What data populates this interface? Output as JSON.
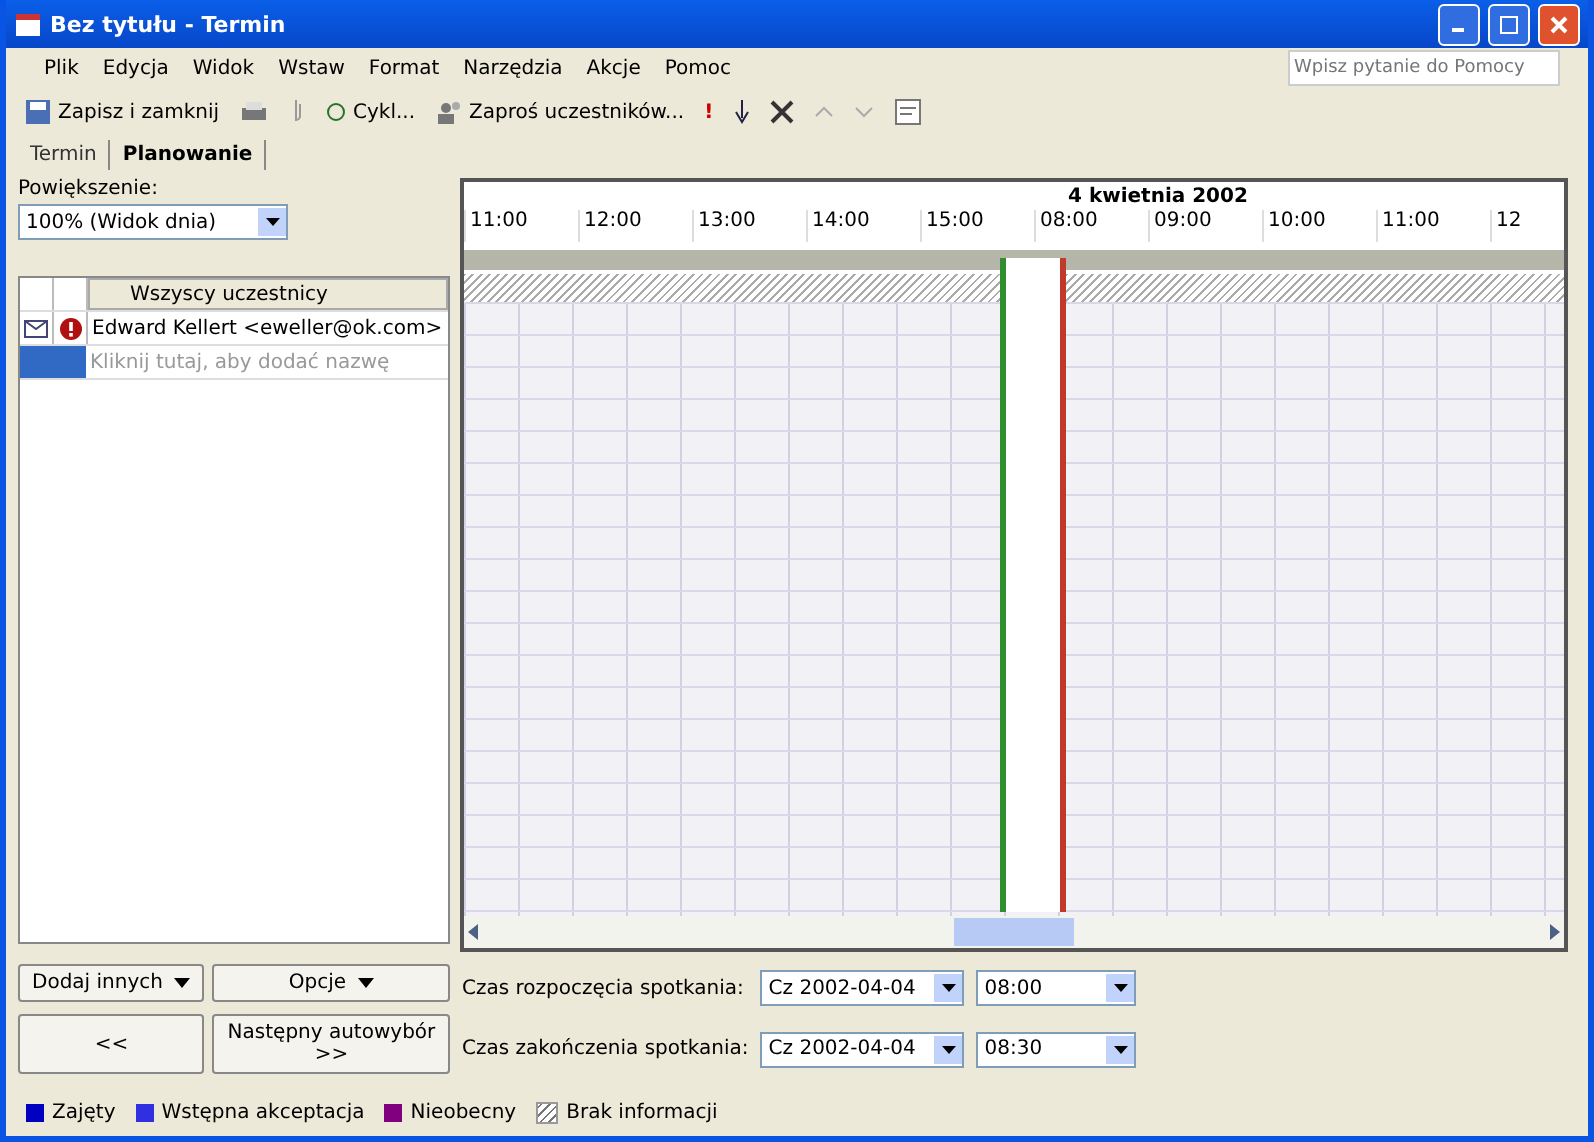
{
  "window": {
    "title": "Bez tytułu - Termin"
  },
  "menu": [
    "Plik",
    "Edycja",
    "Widok",
    "Wstaw",
    "Format",
    "Narzędzia",
    "Akcje",
    "Pomoc"
  ],
  "help_box": {
    "placeholder": "Wpisz pytanie do Pomocy"
  },
  "toolbar": [
    {
      "kind": "save",
      "label": "Zapisz i zamknij"
    },
    {
      "kind": "print"
    },
    {
      "kind": "attach"
    },
    {
      "kind": "recur",
      "label": "Cykl..."
    },
    {
      "kind": "invite",
      "label": "Zaproś uczestników..."
    },
    {
      "kind": "high",
      "label": "!"
    },
    {
      "kind": "low"
    },
    {
      "kind": "delete"
    },
    {
      "kind": "up"
    },
    {
      "kind": "down"
    },
    {
      "kind": "form"
    }
  ],
  "tabs": [
    {
      "label": "Termin",
      "selected": false
    },
    {
      "label": "Planowanie",
      "selected": true
    }
  ],
  "zoom": {
    "label": "Powiększenie:",
    "value": "100% (Widok dnia)"
  },
  "attendees": {
    "header": "Wszyscy uczestnicy",
    "rows": [
      {
        "name": "Edward Kellert <eweller@ok.com>",
        "required": true
      },
      {
        "placeholder": "Kliknij tutaj, aby dodać nazwę",
        "selected": true
      }
    ]
  },
  "timeline": {
    "date": "4 kwietnia 2002",
    "times": [
      {
        "label": "11:00",
        "selected": false
      },
      {
        "label": "12:00",
        "selected": false
      },
      {
        "label": "13:00",
        "selected": false
      },
      {
        "label": "14:00",
        "selected": false
      },
      {
        "label": "15:00",
        "selected": false
      },
      {
        "label": "08:00",
        "selected": true
      },
      {
        "label": "09:00",
        "selected": false
      },
      {
        "label": "10:00",
        "selected": false
      },
      {
        "label": "11:00",
        "selected": false
      },
      {
        "label": "12",
        "selected": false
      }
    ]
  },
  "buttons": [
    {
      "label": "Dodaj innych",
      "dropdown": true
    },
    {
      "label": "Opcje",
      "dropdown": true
    },
    {
      "label": "<<",
      "dropdown": false
    },
    {
      "label": "Następny autowybór >>",
      "dropdown": false
    }
  ],
  "start": {
    "label": "Czas rozpoczęcia spotkania:",
    "date": "Cz 2002-04-04",
    "time": "08:00"
  },
  "end": {
    "label": "Czas zakończenia spotkania:",
    "date": "Cz 2002-04-04",
    "time": "08:30"
  },
  "legend": [
    {
      "label": "Zajęty",
      "color": "#0000c0",
      "kind": "solid"
    },
    {
      "label": "Wstępna akceptacja",
      "color": "#3030e0",
      "kind": "solid"
    },
    {
      "label": "Nieobecny",
      "color": "#800080",
      "kind": "solid"
    },
    {
      "label": "Brak informacji",
      "kind": "hatched"
    }
  ]
}
